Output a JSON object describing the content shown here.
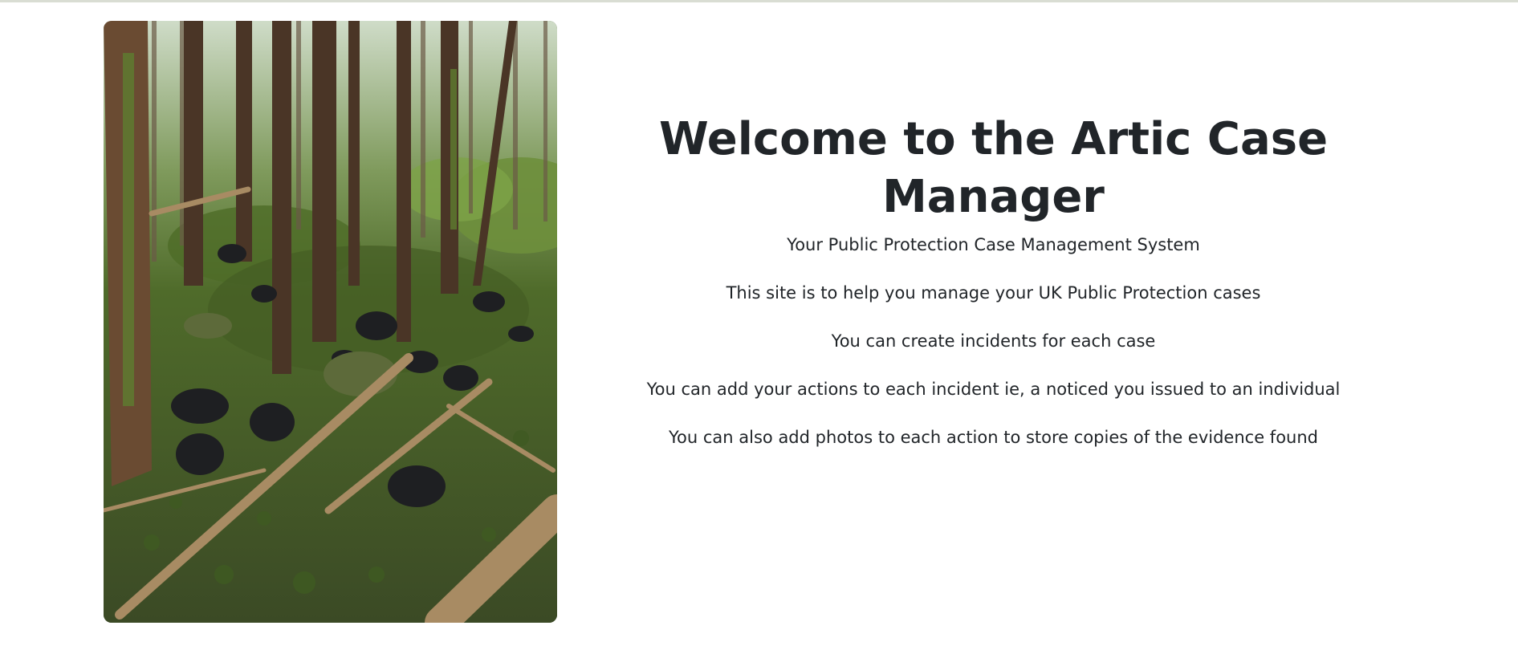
{
  "page": {
    "hero_image": {
      "label": "forest-dumping-photo",
      "colors": {
        "sky": "#cfdcc8",
        "canopy": "#5d7a3a",
        "moss": "#4f6b2a",
        "ground": "#3b4a25",
        "trunk": "#4a3526",
        "branch": "#a88b63",
        "bag": "#1e1f22"
      }
    },
    "title": "Welcome to the Artic Case Manager",
    "subtitle": "Your Public Protection Case Management System",
    "paragraphs": [
      "This site is to help you manage your UK Public Protection cases",
      "You can create incidents for each case",
      "You can add your actions to each incident ie, a noticed you issued to an individual",
      "You can also add photos to each action to store copies of the evidence found"
    ],
    "colors": {
      "text": "#212529",
      "background": "#ffffff",
      "top_rule": "#d9ddd3"
    }
  }
}
